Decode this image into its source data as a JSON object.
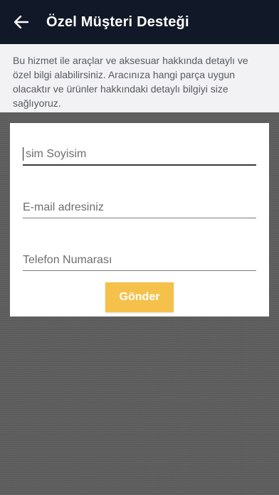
{
  "app_bar": {
    "title": "Özel Müşteri Desteği",
    "back_icon": "arrow-left-icon",
    "background": "#111827"
  },
  "info": {
    "text": "Bu hizmet ile araçlar ve aksesuar hakkında detaylı ve özel bilgi alabilirsiniz. Aracınıza hangi parça uygun olacaktır ve ürünler hakkındaki detaylı bilgiyi size sağlıyoruz."
  },
  "form": {
    "name_placeholder": "sim Soyisim",
    "email_placeholder": "E-mail adresiniz",
    "phone_placeholder": "Telefon Numarası",
    "submit_label": "Gönder",
    "submit_color": "#f5c14b"
  }
}
